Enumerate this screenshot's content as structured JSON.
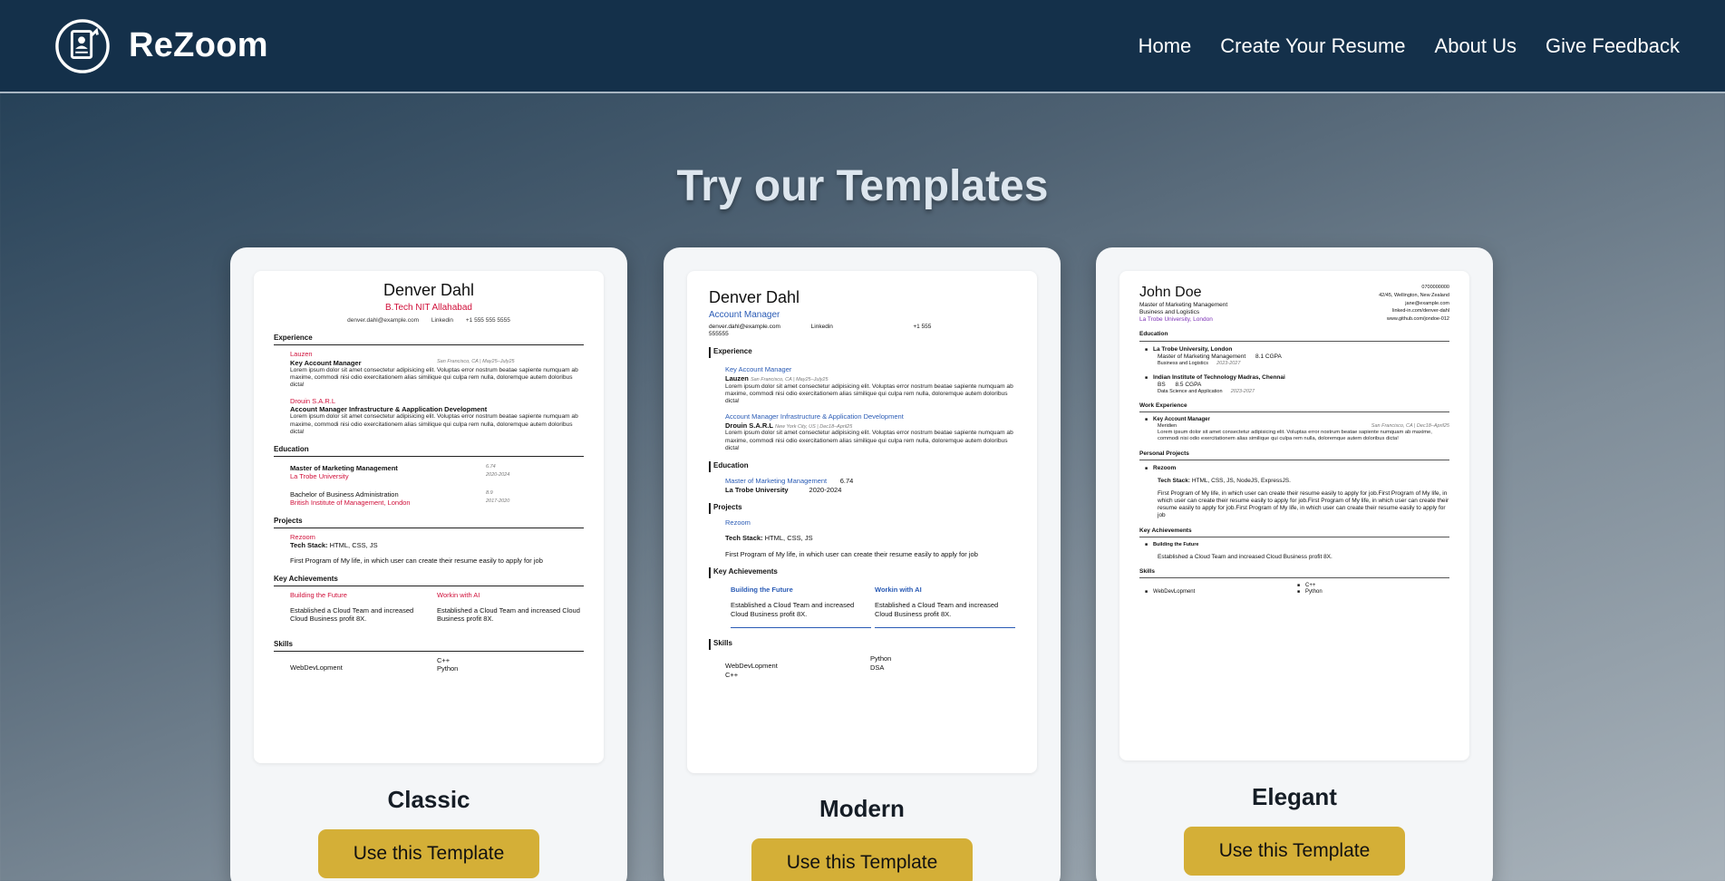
{
  "nav": {
    "brand": "ReZoom",
    "links": [
      "Home",
      "Create Your Resume",
      "About Us",
      "Give Feedback"
    ]
  },
  "hero": {
    "title": "Try our Templates"
  },
  "templates": [
    {
      "name": "Classic",
      "button": "Use this Template",
      "preview": {
        "person": "Denver Dahl",
        "degree": "B.Tech NIT Allahabad",
        "email": "denver.dahl@example.com",
        "linkedin": "Linkedin",
        "phone": "+1 555 555 5555",
        "sec_experience": "Experience",
        "exp1_company": "Lauzen",
        "exp1_role": "Key Account Manager",
        "exp1_loc": "San Francisco, CA | May25–July25",
        "exp2_company": "Drouin S.A.R.L",
        "exp2_role": "Account Manager Infrastructure & Aapplication Development",
        "lorem": "Lorem ipsum dolor sit amet consectetur adipisicing elit. Voluptas error nostrum beatae sapiente numquam ab maxime, commodi nisi odio exercitationem alias similique qui culpa rem nulla, doloremque autem doloribus dicta!",
        "sec_education": "Education",
        "edu1_degree": "Master of Marketing Management",
        "edu1_school": "La Trobe University",
        "edu1_score": "6.74",
        "edu1_years": "2020-2024",
        "edu2_degree": "Bachelor of Business Administration",
        "edu2_school": "British Institute of Management, London",
        "edu2_score": "8.9",
        "edu2_years": "2017-2020",
        "sec_projects": "Projects",
        "proj_name": "Rezoom",
        "proj_stack_label": "Tech Stack:",
        "proj_stack": "HTML, CSS, JS",
        "proj_desc": "First Program of My life, in which user can create their resume easily to apply for job",
        "sec_achievements": "Key Achievements",
        "ach1_title": "Building the Future",
        "ach2_title": "Workin with AI",
        "ach_desc": "Established a Cloud Team and increased Cloud Business profit 8X.",
        "sec_skills": "Skills",
        "skill1": "WebDevLopment",
        "skill2": "C++",
        "skill3": "Python"
      }
    },
    {
      "name": "Modern",
      "button": "Use this Template",
      "preview": {
        "person": "Denver Dahl",
        "role": "Account Manager",
        "email": "denver.dahl@example.com",
        "linkedin": "Linkedin",
        "phone": "+1 555",
        "phone2": "555555",
        "sec_experience": "Experience",
        "exp1_role": "Key Account Manager",
        "exp1_company": "Lauzen",
        "exp1_loc": "San Francisco, CA | May25–July25",
        "exp2_role": "Account Manager Infrastructure & Application Development",
        "exp2_company": "Drouin S.A.R.L",
        "exp2_loc": "New York City, US | Dec18–April25",
        "lorem": "Lorem ipsum dolor sit amet consectetur adipisicing elit. Voluptas error nostrum beatae sapiente numquam ab maxime, commodi nisi odio exercitationem alias similique qui culpa rem nulla, doloremque autem doloribus dicta!",
        "sec_education": "Education",
        "edu1_degree": "Master of Marketing Management",
        "edu1_score": "6.74",
        "edu1_school": "La Trobe University",
        "edu1_years": "2020-2024",
        "sec_projects": "Projects",
        "proj_name": "Rezoom",
        "proj_stack_label": "Tech Stack:",
        "proj_stack": "HTML, CSS, JS",
        "proj_desc": "First Program of My life, in which user can create their resume easily to apply for job",
        "sec_achievements": "Key Achievements",
        "ach1_title": "Building the Future",
        "ach2_title": "Workin with AI",
        "ach_desc": "Established a Cloud Team and increased Cloud Business profit 8X.",
        "sec_skills": "Skills",
        "skill1": "WebDevLopment",
        "skill2": "C++",
        "skill3": "Python",
        "skill4": "DSA"
      }
    },
    {
      "name": "Elegant",
      "button": "Use this Template",
      "preview": {
        "person": "John Doe",
        "title1": "Master of Marketing Management",
        "title2": "Business and Logistics",
        "title3": "La Trobe University, London",
        "phone": "0700000000",
        "address": "42/45, Wellington, New Zealand",
        "email": "jane@example.com",
        "linkedin": "linked-in.com/denver-dahl",
        "github": "www.github.com/jondoe-012",
        "sec_education": "Education",
        "edu1_school": "La Trobe University, London",
        "edu1_degree": "Master of Marketing Management",
        "edu1_score": "8.1 CGPA",
        "edu1_field": "Business and Logistics",
        "edu1_years": "2023-2027",
        "edu2_school": "Indian Institute of Technology Madras, Chennai",
        "edu2_degree": "BS",
        "edu2_score": "8.5 CGPA",
        "edu2_field": "Data Science and Application",
        "edu2_years": "2023-2027",
        "sec_work": "Work Experience",
        "work_role": "Key Account Manager",
        "work_company": "Meridien",
        "work_loc": "San Francisco, CA | Dec18–April25",
        "lorem": "Lorem ipsum dolor sit amet consectetur adipisicing elit. Voluptas error nostrum beatae sapiente numquam ab maxime, commodi nisi odio exercitationem alias similique qui culpa rem nulla, doloremque autem doloribus dicta!",
        "sec_projects": "Personal Projects",
        "proj_name": "Rezoom",
        "proj_stack_label": "Tech Stack:",
        "proj_stack": "HTML, CSS, JS, NodeJS, ExpressJS.",
        "proj_desc": "First Program of My life, in which user can create their resume easily to apply for job.First Program of My life, in which user can create their resume easily to apply for job.First Program of My life, in which user can create their resume easily to apply for job.First Program of My life, in which user can create their resume easily to apply for job",
        "sec_achievements": "Key Achievements",
        "ach1_title": "Building the Future",
        "ach_desc": "Established a Cloud Team and increased Cloud Business profit 8X.",
        "sec_skills": "Skills",
        "skill1": "WebDevLopment",
        "skill2": "C++",
        "skill3": "Python"
      }
    }
  ]
}
